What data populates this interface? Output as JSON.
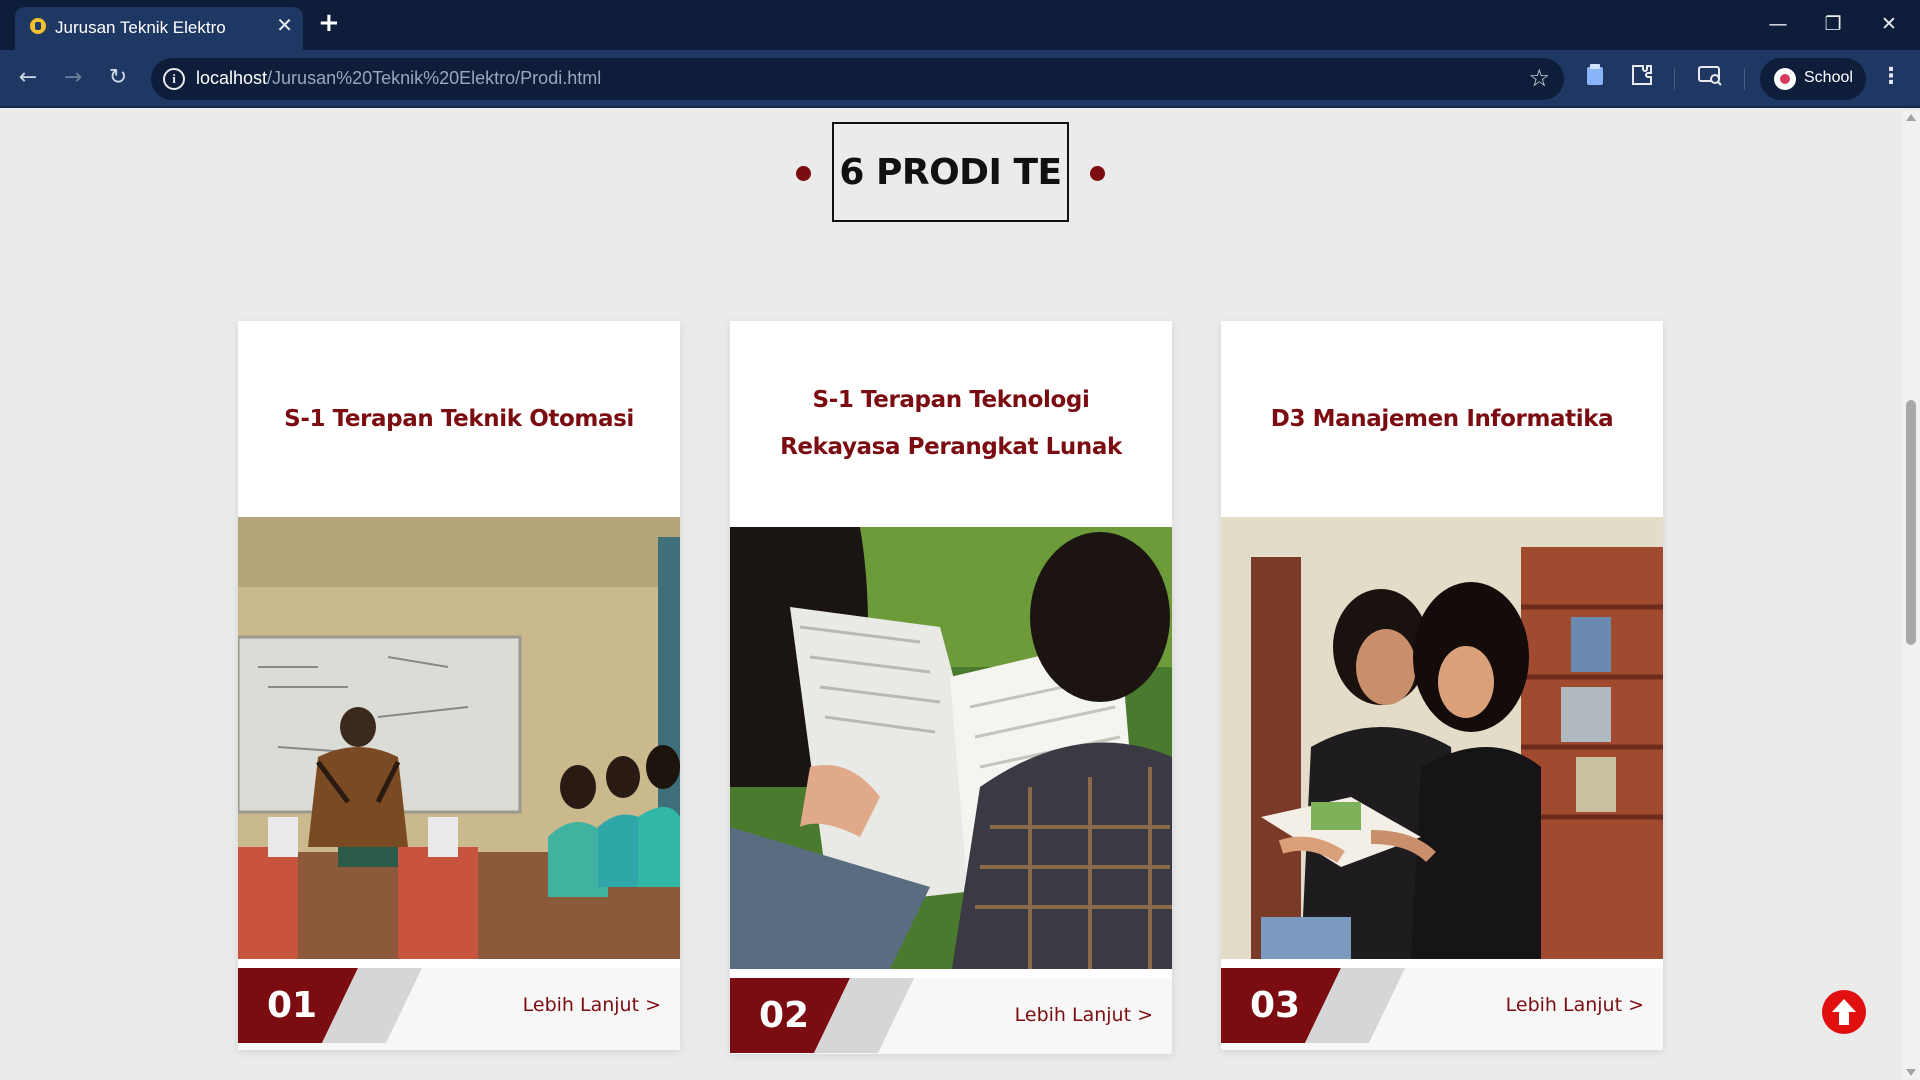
{
  "browser": {
    "tab_title": "Jurusan Teknik Elektro",
    "tab_close": "✕",
    "new_tab": "+",
    "url_host": "localhost",
    "url_path": "/Jurusan%20Teknik%20Elektro/Prodi.html",
    "profile_name": "School",
    "window_controls": {
      "minimize": "—",
      "restore": "❐",
      "close": "✕"
    },
    "nav": {
      "back": "←",
      "forward": "→",
      "reload": "↻"
    },
    "menu": "⋮",
    "colors": {
      "tabbar": "#0e1e3a",
      "toolbar": "#1e3763"
    }
  },
  "page": {
    "heading": "6 PRODI TE",
    "accent_color": "#7b0d12",
    "cards": [
      {
        "title": "S-1 Terapan Teknik Otomasi",
        "number": "01",
        "link": "Lebih Lanjut >"
      },
      {
        "title": "S-1 Terapan Teknologi Rekayasa Perangkat Lunak",
        "number": "02",
        "link": "Lebih Lanjut >"
      },
      {
        "title": "D3 Manajemen Informatika",
        "number": "03",
        "link": "Lebih Lanjut >"
      }
    ],
    "back_to_top_color": "#e01010"
  }
}
